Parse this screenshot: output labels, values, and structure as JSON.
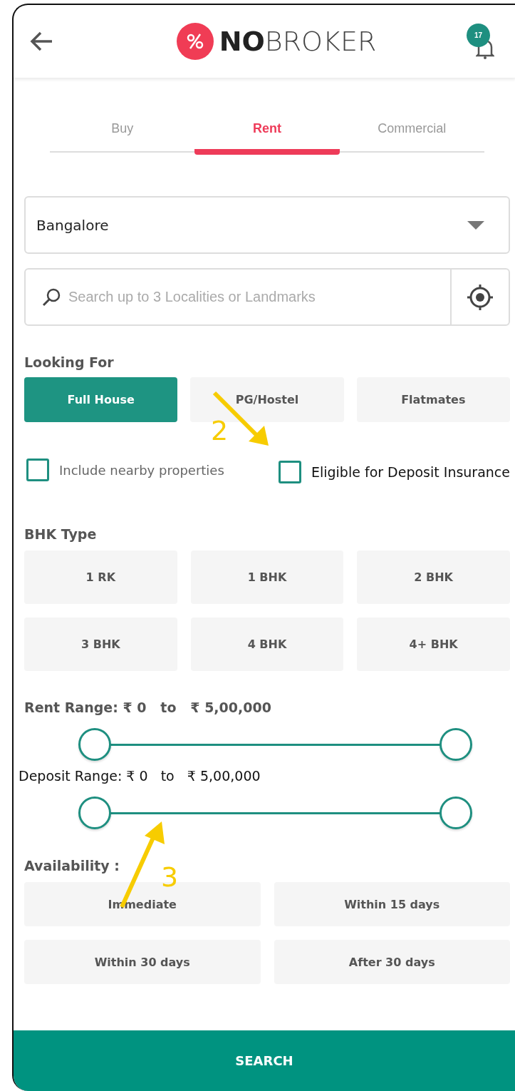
{
  "header": {
    "logo_bold": "NO",
    "logo_light": "BROKER",
    "notification_count": "17"
  },
  "tabs": [
    {
      "label": "Buy",
      "selected": false
    },
    {
      "label": "Rent",
      "selected": true
    },
    {
      "label": "Commercial",
      "selected": false
    }
  ],
  "city": {
    "value": "Bangalore"
  },
  "search": {
    "placeholder": "Search up to 3 Localities or Landmarks"
  },
  "looking_for": {
    "title": "Looking For",
    "options": [
      {
        "label": "Full House",
        "selected": true
      },
      {
        "label": "PG/Hostel",
        "selected": false
      },
      {
        "label": "Flatmates",
        "selected": false
      }
    ]
  },
  "checkboxes": [
    {
      "label": "Include nearby properties",
      "checked": false
    },
    {
      "label": "Eligible for Deposit Insurance",
      "checked": false
    }
  ],
  "bhk": {
    "title": "BHK Type",
    "options": [
      {
        "label": "1 RK",
        "selected": false
      },
      {
        "label": "1 BHK",
        "selected": false
      },
      {
        "label": "2 BHK",
        "selected": false
      },
      {
        "label": "3 BHK",
        "selected": false
      },
      {
        "label": "4 BHK",
        "selected": false
      },
      {
        "label": "4+ BHK",
        "selected": false
      }
    ]
  },
  "ranges": [
    {
      "label": "Rent Range: ₹ 0   to   ₹ 5,00,000",
      "thumbs": [
        {
          "level": 0
        },
        {
          "level": 1
        }
      ]
    },
    {
      "label": "Deposit Range: ₹ 0   to   ₹ 5,00,000",
      "thumbs": [
        {
          "level": 0
        },
        {
          "level": 1
        }
      ]
    }
  ],
  "availability": {
    "title": "Availability :",
    "options": [
      {
        "label": "Immediate",
        "selected": false
      },
      {
        "label": "Within 15 days",
        "selected": false
      },
      {
        "label": "Within 30 days",
        "selected": false
      },
      {
        "label": "After 30 days",
        "selected": false
      }
    ]
  },
  "search_button": "SEARCH",
  "annotations": [
    "2",
    "3"
  ]
}
